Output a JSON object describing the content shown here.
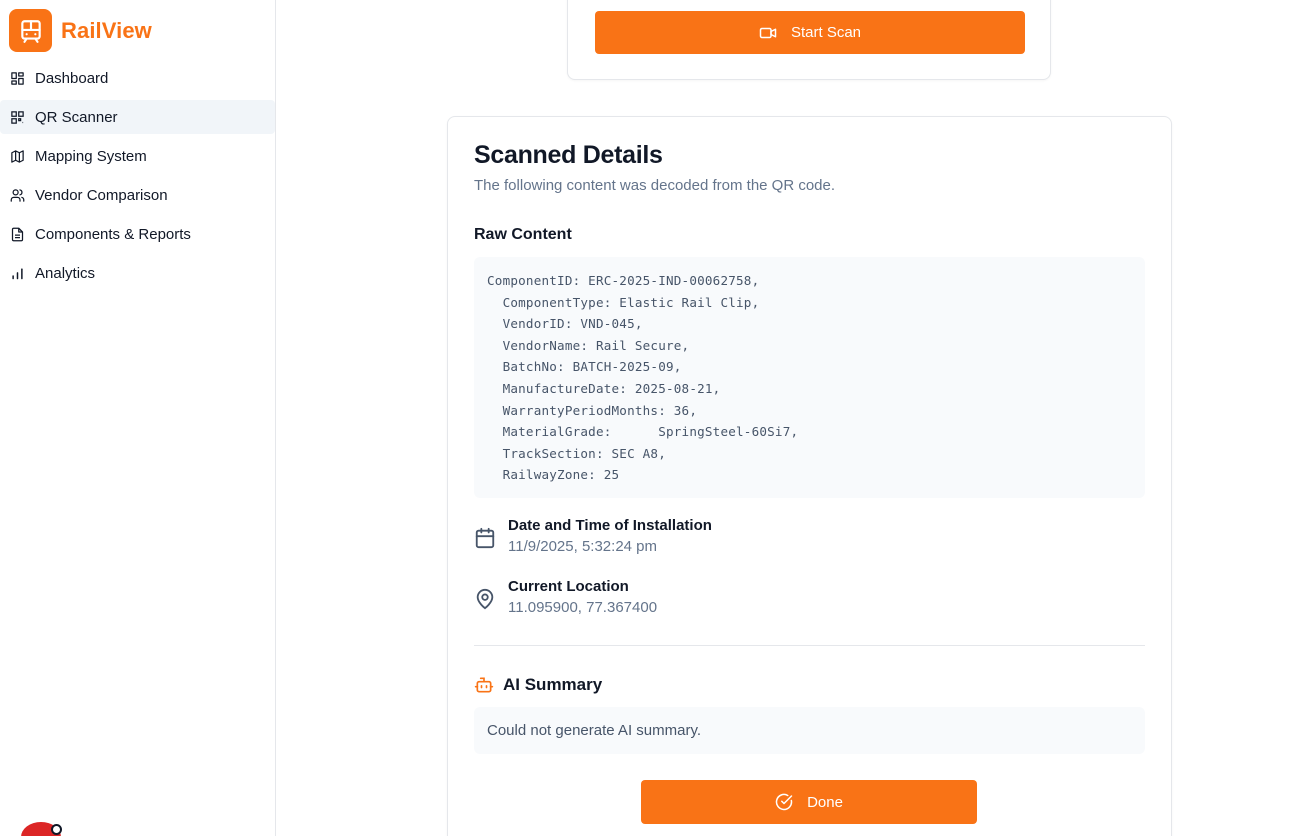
{
  "app": {
    "name": "RailView"
  },
  "sidebar": {
    "items": [
      {
        "label": "Dashboard",
        "icon": "dashboard-icon",
        "active": false
      },
      {
        "label": "QR Scanner",
        "icon": "qr-code-icon",
        "active": true
      },
      {
        "label": "Mapping System",
        "icon": "map-icon",
        "active": false
      },
      {
        "label": "Vendor Comparison",
        "icon": "users-icon",
        "active": false
      },
      {
        "label": "Components & Reports",
        "icon": "file-text-icon",
        "active": false
      },
      {
        "label": "Analytics",
        "icon": "bar-chart-icon",
        "active": false
      }
    ]
  },
  "scan": {
    "start_label": "Start Scan",
    "start_icon": "video-camera-icon"
  },
  "details": {
    "title": "Scanned Details",
    "subtitle": "The following content was decoded from the QR code.",
    "raw_label": "Raw Content",
    "raw_content": "ComponentID: ERC-2025-IND-00062758,\n  ComponentType: Elastic Rail Clip,\n  VendorID: VND-045,\n  VendorName: Rail Secure,\n  BatchNo: BATCH-2025-09,\n  ManufactureDate: 2025-08-21,\n  WarrantyPeriodMonths: 36,\n  MaterialGrade:      SpringSteel-60Si7,\n  TrackSection: SEC A8,\n  RailwayZone: 25",
    "installation": {
      "label": "Date and Time of Installation",
      "value": "11/9/2025, 5:32:24 pm",
      "icon": "calendar-icon"
    },
    "location": {
      "label": "Current Location",
      "value": "11.095900, 77.367400",
      "icon": "map-pin-icon"
    },
    "ai": {
      "title": "AI Summary",
      "message": "Could not generate AI summary.",
      "icon": "bot-icon"
    },
    "done_label": "Done",
    "done_icon": "check-circle-icon"
  },
  "colors": {
    "accent": "#f97316",
    "active_bg": "#f1f5f9",
    "muted_text": "#64748b",
    "border": "#e5e7eb"
  }
}
